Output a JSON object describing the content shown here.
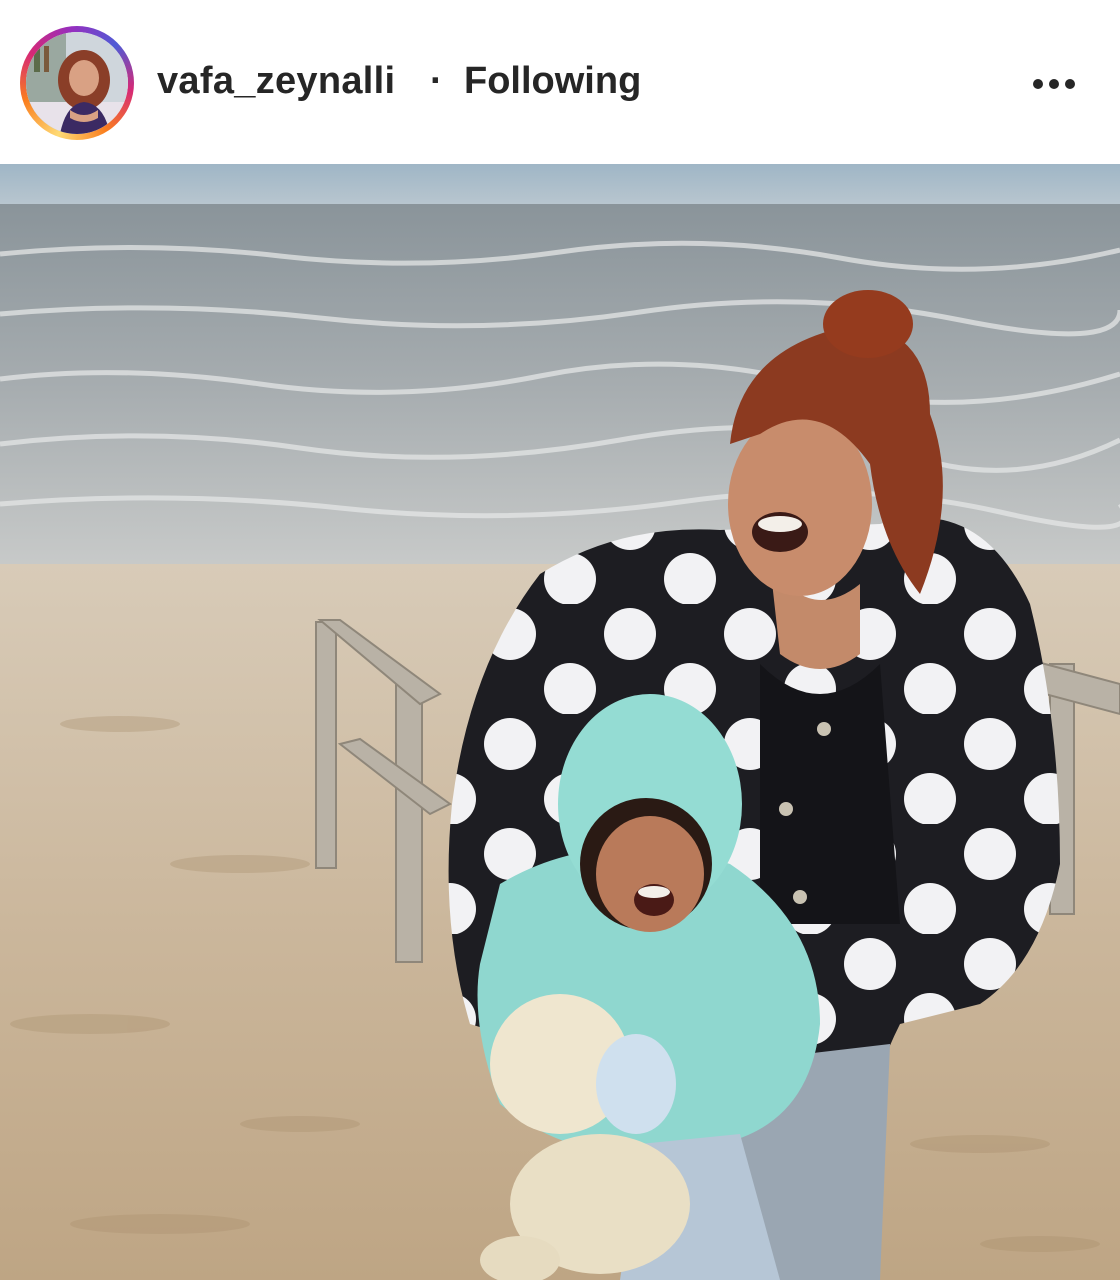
{
  "post": {
    "username": "vafa_zeynalli",
    "separator": "·",
    "follow_status": "Following",
    "more_icon": "more-horizontal-icon",
    "avatar_icon": "profile-picture"
  },
  "colors": {
    "text": "#262626",
    "story_ring": [
      "#feda75",
      "#fa7e1e",
      "#d62976",
      "#962fbf"
    ]
  }
}
